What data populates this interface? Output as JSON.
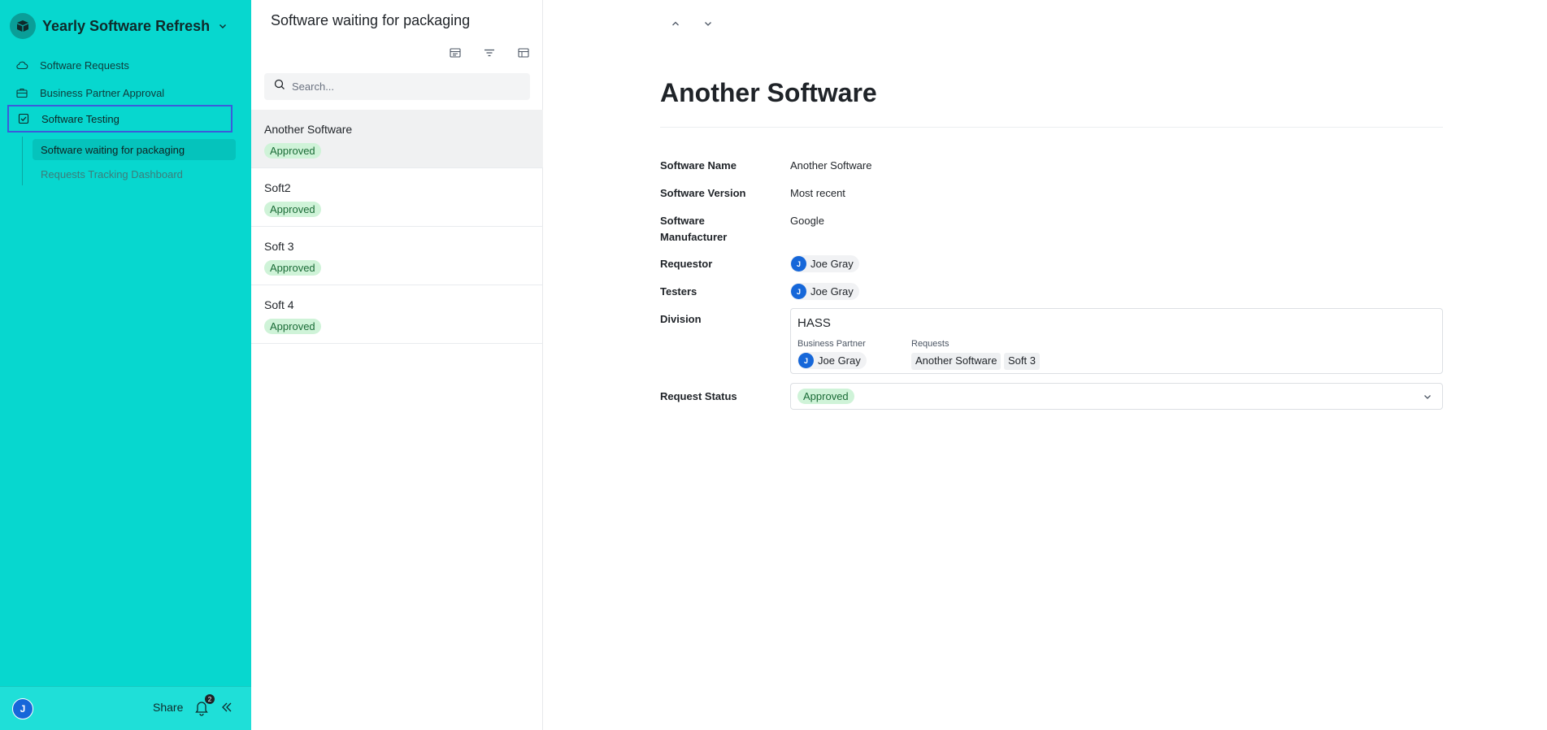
{
  "app": {
    "title": "Yearly Software Refresh"
  },
  "sidebar": {
    "items": [
      {
        "label": "Software Requests",
        "icon": "cloud-icon"
      },
      {
        "label": "Business Partner Approval",
        "icon": "briefcase-icon"
      },
      {
        "label": "Software Testing",
        "icon": "checkbox-icon"
      }
    ],
    "sub_items": [
      {
        "label": "Software waiting for packaging"
      },
      {
        "label": "Requests Tracking Dashboard"
      }
    ],
    "footer": {
      "avatar_initial": "J",
      "share_label": "Share",
      "notification_count": "2"
    }
  },
  "list": {
    "title": "Software waiting for packaging",
    "search_placeholder": "Search...",
    "records": [
      {
        "name": "Another Software",
        "status": "Approved"
      },
      {
        "name": "Soft2",
        "status": "Approved"
      },
      {
        "name": "Soft 3",
        "status": "Approved"
      },
      {
        "name": "Soft 4",
        "status": "Approved"
      }
    ]
  },
  "detail": {
    "title": "Another Software",
    "fields": {
      "software_name_label": "Software Name",
      "software_name": "Another Software",
      "software_version_label": "Software Version",
      "software_version": "Most recent",
      "software_manufacturer_label": "Software Manufacturer",
      "software_manufacturer": "Google",
      "requestor_label": "Requestor",
      "requestor": {
        "initial": "J",
        "name": "Joe Gray"
      },
      "testers_label": "Testers",
      "testers": {
        "initial": "J",
        "name": "Joe Gray"
      },
      "division_label": "Division",
      "division": {
        "name": "HASS",
        "business_partner_label": "Business Partner",
        "business_partner": {
          "initial": "J",
          "name": "Joe Gray"
        },
        "requests_label": "Requests",
        "requests": [
          "Another Software",
          "Soft 3"
        ]
      },
      "request_status_label": "Request Status",
      "request_status": "Approved"
    }
  },
  "colors": {
    "sidebar_bg": "#07d7cf",
    "accent_blue": "#1667d9",
    "badge_green_bg": "#cff3d8",
    "badge_green_text": "#1a6b36",
    "selection_border": "#3b5bdb"
  }
}
